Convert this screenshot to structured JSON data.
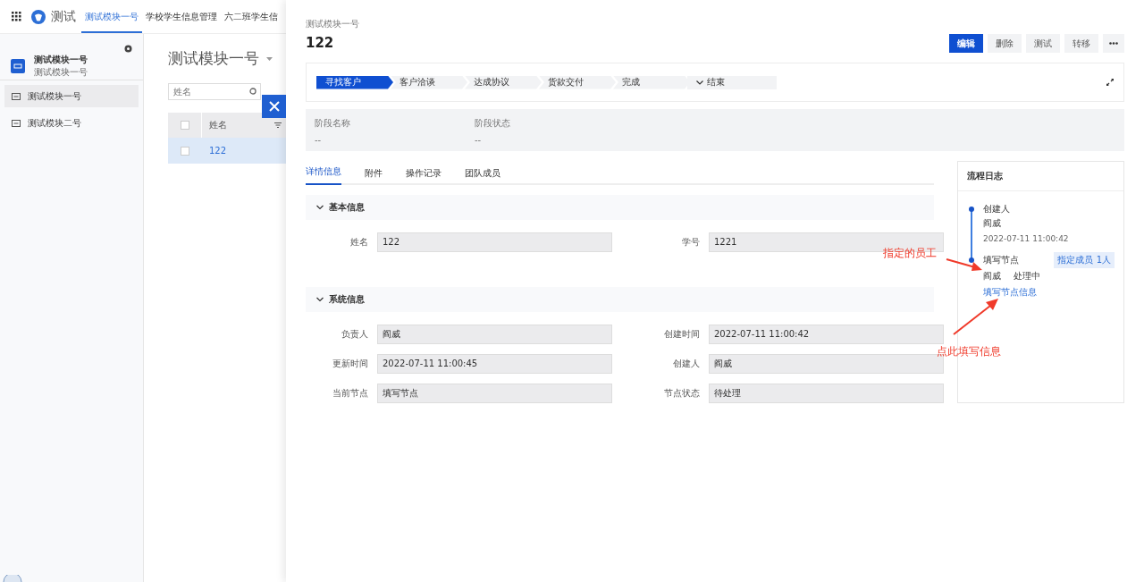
{
  "app": {
    "title": "测试",
    "nav_tabs": [
      {
        "label": "测试模块一号",
        "selected": true
      },
      {
        "label": "学校学生信息管理",
        "selected": false
      },
      {
        "label": "六二班学生信",
        "selected": false
      }
    ]
  },
  "sidebar": {
    "header": {
      "title": "测试模块一号",
      "subtitle": "测试模块一号"
    },
    "items": [
      {
        "label": "测试模块一号",
        "selected": true
      },
      {
        "label": "测试模块二号",
        "selected": false
      }
    ]
  },
  "list": {
    "title": "测试模块一号",
    "search": {
      "placeholder": "姓名"
    },
    "columns": [
      "姓名"
    ],
    "all_checked": false,
    "rows": [
      {
        "cells": [
          "122"
        ],
        "selected": true,
        "checked": false
      }
    ]
  },
  "drawer": {
    "breadcrumb": "测试模块一号",
    "title": "122",
    "actions": [
      {
        "label": "编辑",
        "primary": true
      },
      {
        "label": "删除",
        "primary": false
      },
      {
        "label": "测试",
        "primary": false
      },
      {
        "label": "转移",
        "primary": false
      }
    ],
    "stages": [
      {
        "label": "寻找客户",
        "selected": true,
        "kind": "step"
      },
      {
        "label": "客户洽谈",
        "selected": false,
        "kind": "step"
      },
      {
        "label": "达成协议",
        "selected": false,
        "kind": "step"
      },
      {
        "label": "货款交付",
        "selected": false,
        "kind": "step"
      },
      {
        "label": "完成",
        "selected": false,
        "kind": "step"
      },
      {
        "label": "结束",
        "selected": false,
        "kind": "end"
      }
    ],
    "stage_info": [
      {
        "label": "阶段名称",
        "value": "--"
      },
      {
        "label": "阶段状态",
        "value": "--"
      }
    ],
    "tabs": [
      {
        "label": "详情信息",
        "selected": true
      },
      {
        "label": "附件",
        "selected": false
      },
      {
        "label": "操作记录",
        "selected": false
      },
      {
        "label": "团队成员",
        "selected": false
      }
    ],
    "sections": [
      {
        "title": "基本信息",
        "expanded": true,
        "fields": [
          {
            "label": "姓名",
            "value": "122"
          },
          {
            "label": "学号",
            "value": "1221"
          }
        ]
      },
      {
        "title": "系统信息",
        "expanded": true,
        "fields": [
          {
            "label": "负责人",
            "value": "阎威"
          },
          {
            "label": "创建时间",
            "value": "2022-07-11 11:00:42"
          },
          {
            "label": "更新时间",
            "value": "2022-07-11 11:00:45"
          },
          {
            "label": "创建人",
            "value": "阎威"
          },
          {
            "label": "当前节点",
            "value": "填写节点"
          },
          {
            "label": "节点状态",
            "value": "待处理"
          }
        ]
      }
    ],
    "log": {
      "title": "流程日志",
      "entries": [
        {
          "title": "创建人",
          "person": "阎威",
          "time": "2022-07-11 11:00:42"
        },
        {
          "title": "填写节点",
          "badge": "指定成员 1人",
          "person": "阎威",
          "status": "处理中",
          "link": "填写节点信息"
        }
      ]
    }
  },
  "annotations": [
    {
      "text": "指定的员工"
    },
    {
      "text": "点此填写信息"
    }
  ]
}
